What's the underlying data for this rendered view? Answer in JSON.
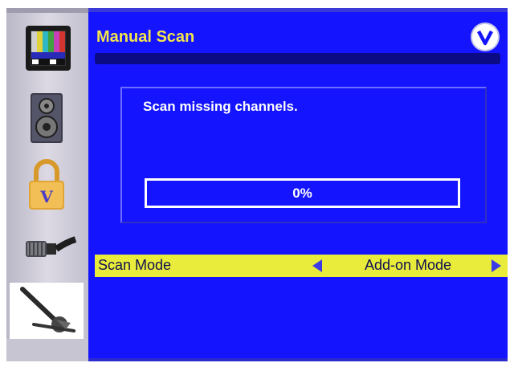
{
  "header": {
    "title": "Manual Scan",
    "logo_icon": "vizio-v-logo-icon"
  },
  "sidebar": {
    "items": [
      {
        "icon": "tv-picture-icon",
        "selected": false
      },
      {
        "icon": "speaker-audio-icon",
        "selected": false
      },
      {
        "icon": "padlock-parental-icon",
        "selected": false
      },
      {
        "icon": "coax-cable-icon",
        "selected": false
      },
      {
        "icon": "wrench-setup-icon",
        "selected": true
      }
    ]
  },
  "scan": {
    "message": "Scan missing channels.",
    "progress_text": "0%",
    "progress_value": 0
  },
  "scan_mode": {
    "label": "Scan Mode",
    "value": "Add-on Mode",
    "left_arrow_icon": "left-arrow-icon",
    "right_arrow_icon": "right-arrow-icon"
  },
  "colors": {
    "panel": "#1414ff",
    "title": "#f3e54a",
    "highlight_row": "#e9ec3b",
    "arrow": "#3c3ce6"
  }
}
